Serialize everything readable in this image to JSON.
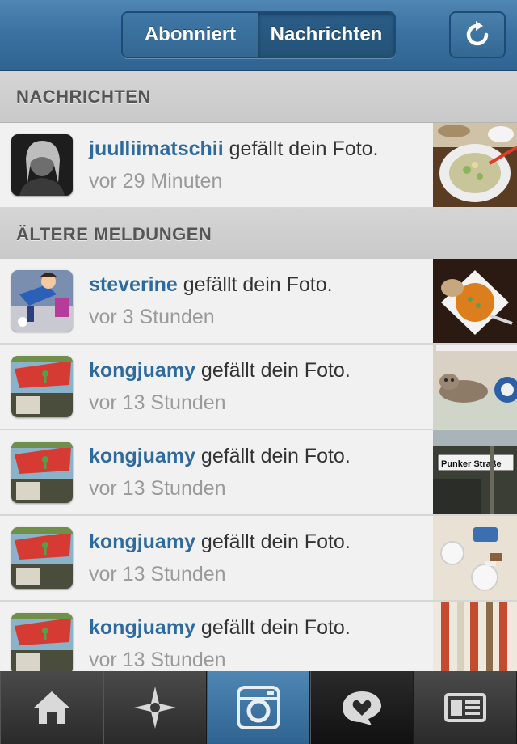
{
  "header": {
    "tabs": [
      {
        "label": "Abonniert",
        "selected": false
      },
      {
        "label": "Nachrichten",
        "selected": true
      }
    ],
    "refresh_icon": "refresh-icon"
  },
  "sections": {
    "news": "NACHRICHTEN",
    "older": "ÄLTERE MELDUNGEN"
  },
  "items": [
    {
      "user": "juulliimatschii",
      "action": " gefällt dein Foto.",
      "time": "vor 29 Minuten"
    },
    {
      "user": "steverine",
      "action": " gefällt dein Foto.",
      "time": "vor 3 Stunden"
    },
    {
      "user": "kongjuamy",
      "action": " gefällt dein Foto.",
      "time": "vor 13 Stunden"
    },
    {
      "user": "kongjuamy",
      "action": " gefällt dein Foto.",
      "time": "vor 13 Stunden"
    },
    {
      "user": "kongjuamy",
      "action": " gefällt dein Foto.",
      "time": "vor 13 Stunden"
    },
    {
      "user": "kongjuamy",
      "action": " gefällt dein Foto.",
      "time": "vor 13 Stunden"
    }
  ],
  "thumb_text": {
    "street_sign": "Punker Straße"
  },
  "tabbar": [
    {
      "icon": "home-icon"
    },
    {
      "icon": "explore-icon"
    },
    {
      "icon": "camera-icon"
    },
    {
      "icon": "news-icon"
    },
    {
      "icon": "profile-icon"
    }
  ],
  "colors": {
    "accent": "#2e6a9e",
    "header": "#3a70a0"
  }
}
